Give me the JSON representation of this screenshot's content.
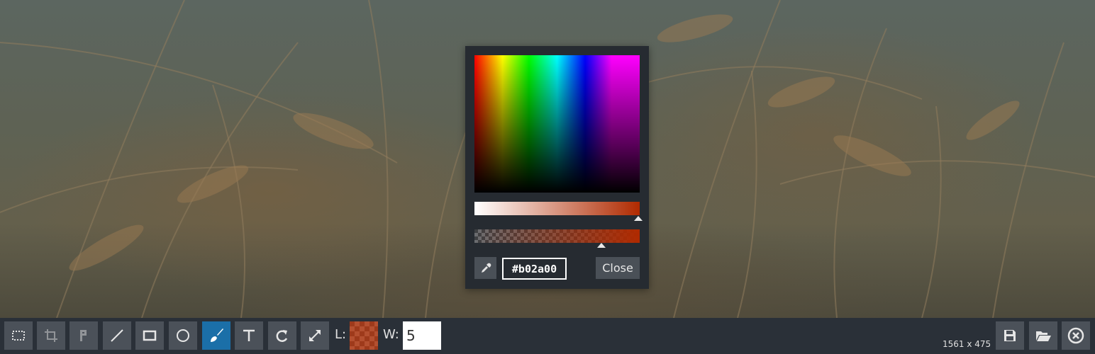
{
  "color_picker": {
    "hex_value": "#b02a00",
    "close_label": "Close",
    "selected_color": "#b02a00",
    "lightness_level": 1.0,
    "alpha_level": 0.77
  },
  "toolbar": {
    "tools": [
      {
        "name": "select",
        "icon": "select-rect-icon"
      },
      {
        "name": "crop",
        "icon": "crop-icon"
      },
      {
        "name": "pixelize",
        "icon": "pixelize-icon"
      },
      {
        "name": "line",
        "icon": "line-icon"
      },
      {
        "name": "rectangle",
        "icon": "rectangle-icon"
      },
      {
        "name": "ellipse",
        "icon": "ellipse-icon"
      },
      {
        "name": "brush",
        "icon": "brush-icon",
        "active": true
      },
      {
        "name": "text",
        "icon": "text-icon"
      },
      {
        "name": "rotate",
        "icon": "rotate-icon"
      },
      {
        "name": "resize",
        "icon": "resize-icon"
      }
    ],
    "line_label": "L:",
    "width_label": "W:",
    "width_value": "5",
    "image_dimensions": "1561 x 475",
    "actions": [
      {
        "name": "save",
        "icon": "save-icon"
      },
      {
        "name": "open",
        "icon": "folder-open-icon"
      },
      {
        "name": "close",
        "icon": "close-circle-icon"
      }
    ]
  },
  "colors": {
    "accent_active": "#1b6fa8",
    "toolbar_bg": "#2a3038",
    "button_bg": "#4b5159"
  }
}
